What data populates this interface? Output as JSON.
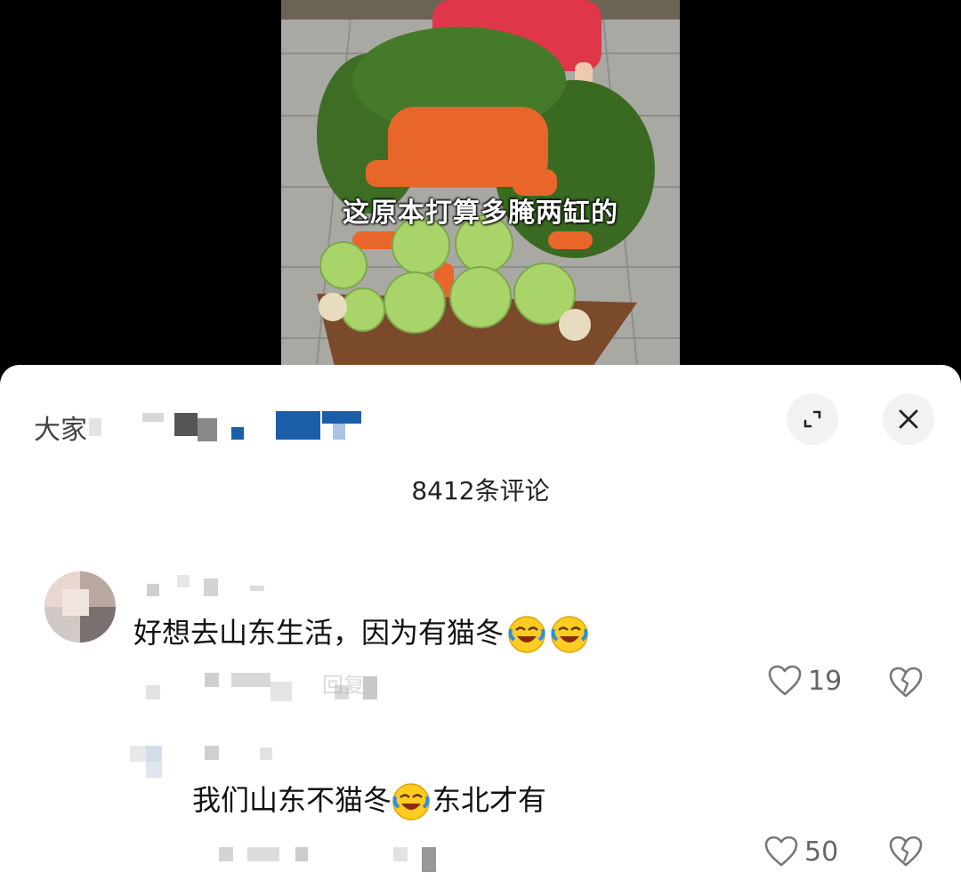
{
  "video": {
    "caption": "这原本打算多腌两缸的"
  },
  "sheet": {
    "title_visible": "大家",
    "comment_count": "8412条评论"
  },
  "comments": [
    {
      "text": "好想去山东生活，因为有猫冬",
      "likes": "19",
      "reply_label": "回复"
    },
    {
      "text_before": "我们山东不猫冬",
      "text_after": "东北才有",
      "likes": "50"
    }
  ],
  "icons": {
    "expand": "expand-icon",
    "close": "close-icon",
    "like": "heart-outline-icon",
    "dislike": "broken-heart-icon",
    "emoji": "crying-laughing-emoji"
  },
  "colors": {
    "accent_blue": "#1a5ea8",
    "text_main": "#111111",
    "text_meta": "#666666"
  }
}
